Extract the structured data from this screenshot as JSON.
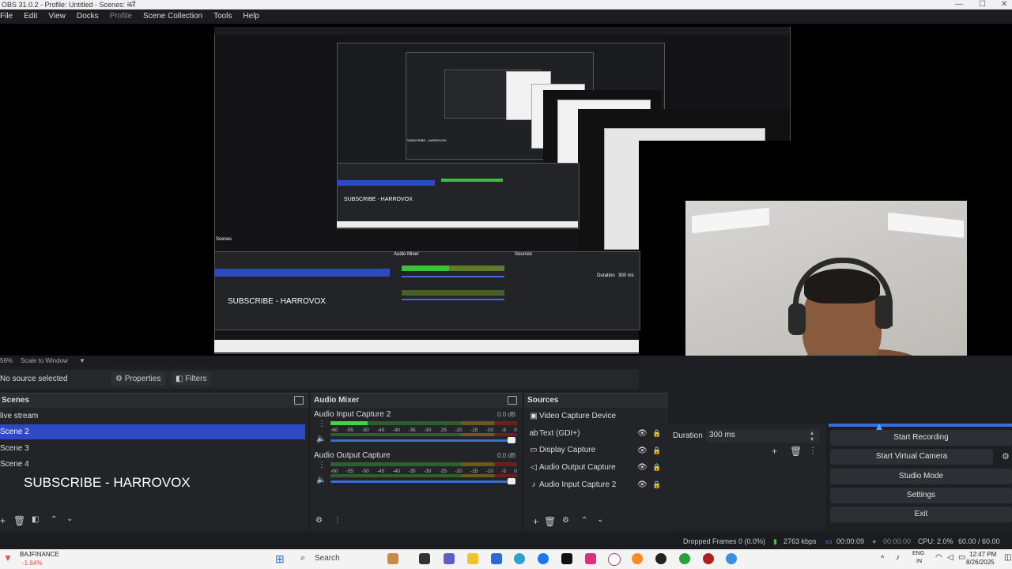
{
  "window": {
    "title": "OBS 31.0.2 - Profile: Untitled - Scenes: करें",
    "controls": [
      "—",
      "☐",
      "✕"
    ]
  },
  "menu": [
    "File",
    "Edit",
    "View",
    "Docks",
    "Profile",
    "Scene Collection",
    "Tools",
    "Help"
  ],
  "preview": {
    "nested_subscribe_1": "SUBSCRIBE - HARROVOX",
    "nested_subscribe_2": "SUBSCRIBE - HARROVOX",
    "nested_subscribe_3": "SUBSCRIBE - HARROVOX",
    "nested_audio_mixer": "Audio Mixer",
    "nested_sources": "Sources",
    "nested_scenes": "Scenes",
    "nested_duration": "Duration",
    "nested_duration_value": "300 ms"
  },
  "zoom": {
    "percent": "56%",
    "scale": "Scale to Window"
  },
  "properties_bar": {
    "no_source": "No source selected",
    "properties": "Properties",
    "filters": "Filters"
  },
  "scenes": {
    "title": "Scenes",
    "items": [
      "live stream",
      "Scene 2",
      "Scene 3",
      "Scene 4"
    ],
    "selected_index": 1
  },
  "overlay_text": "SUBSCRIBE - HARROVOX",
  "mixer": {
    "title": "Audio Mixer",
    "channels": [
      {
        "name": "Audio Input Capture 2",
        "db": "0.0 dB",
        "level": 0.2
      },
      {
        "name": "Audio Output Capture",
        "db": "0.0 dB",
        "level": 0.0
      }
    ],
    "ticks": [
      "-60",
      "-55",
      "-50",
      "-45",
      "-40",
      "-35",
      "-30",
      "-25",
      "-20",
      "-15",
      "-10",
      "-5",
      "0"
    ]
  },
  "sources": {
    "title": "Sources",
    "items": [
      {
        "name": "Video Capture Device",
        "icon": "camera-icon"
      },
      {
        "name": "Text (GDI+)",
        "icon": "text-icon"
      },
      {
        "name": "Display Capture",
        "icon": "monitor-icon"
      },
      {
        "name": "Audio Output Capture",
        "icon": "speaker-icon"
      },
      {
        "name": "Audio Input Capture 2",
        "icon": "mic-icon"
      }
    ]
  },
  "transition": {
    "duration_label": "Duration",
    "duration_value": "300 ms"
  },
  "controls": {
    "start_recording": "Start Recording",
    "start_virtual_camera": "Start Virtual Camera",
    "studio_mode": "Studio Mode",
    "settings": "Settings",
    "exit": "Exit"
  },
  "status": {
    "dropped_frames": "Dropped Frames 0 (0.0%)",
    "bitrate": "2763 kbps",
    "stream_time": "00:00:09",
    "rec_time": "00:00:00",
    "cpu": "CPU: 2.0%",
    "fps": "60.00 / 60.00 FPS"
  },
  "taskbar": {
    "stock_name": "BAJFINANCE",
    "stock_change": "-1.64%",
    "search": "Search",
    "lang_top": "ENG",
    "lang_bottom": "IN",
    "time": "12:47 PM",
    "date": "8/26/2025"
  },
  "colors": {
    "selected": "#2e49c4",
    "slider": "#3a6ed6",
    "stock_down": "#e05050"
  }
}
